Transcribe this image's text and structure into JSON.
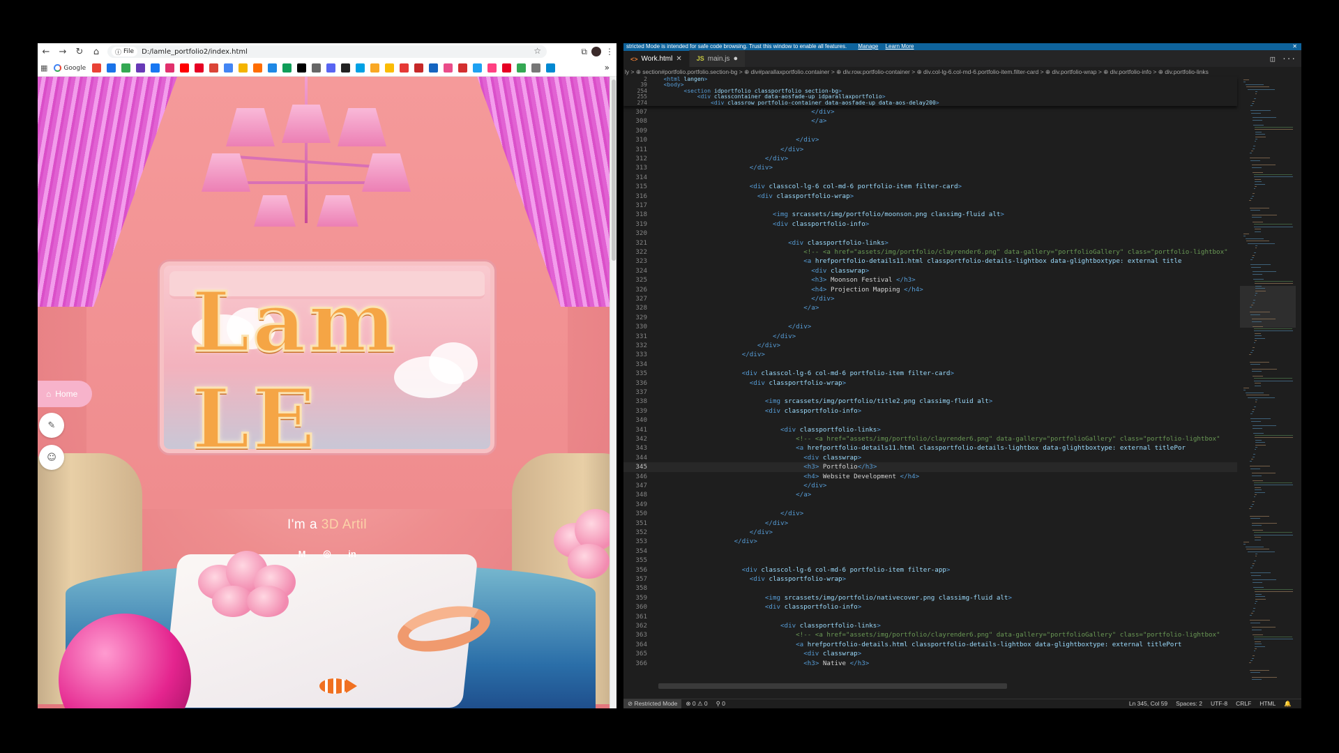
{
  "browser": {
    "nav": {
      "back": "←",
      "forward": "→",
      "reload": "↻",
      "home": "⌂"
    },
    "chip_label": "File",
    "url": "D:/lamle_portfolio2/index.html",
    "star": "☆",
    "right_icons": [
      "⧉",
      "⋮"
    ],
    "bookmark_google": "Google",
    "bookmark_more": "»",
    "bookmark_colors": [
      "#e94235",
      "#1a73e8",
      "#34a853",
      "#673ab7",
      "#1877f2",
      "#e1306c",
      "#ff0000",
      "#e60023",
      "#db4437",
      "#4285f4",
      "#f4b400",
      "#ff6d00",
      "#1e88e5",
      "#0f9d58",
      "#000000",
      "#666666",
      "#5865f2",
      "#222222",
      "#00a1e4",
      "#f9a825",
      "#fbbc04",
      "#e53935",
      "#c62828",
      "#1565c0",
      "#ea4c89",
      "#d32f2f",
      "#1da1f2",
      "#ff4081",
      "#e60023",
      "#34a853",
      "#777777",
      "#0288d1"
    ]
  },
  "page": {
    "logo": "Lam LE",
    "hero_prefix": "I'm a ",
    "hero_accent": "3D Artil",
    "social": {
      "mail": "M",
      "instagram": "◎",
      "linkedin": "in"
    },
    "nav_home": "Home",
    "nav_home_icon": "⌂",
    "nav_brush_icon": "✎",
    "nav_user_icon": "☺"
  },
  "vscode": {
    "banner": "stricted Mode is intended for safe code browsing. Trust this window to enable all features.",
    "banner_manage": "Manage",
    "banner_learn": "Learn More",
    "banner_close": "✕",
    "tabs": [
      {
        "icon": "<>",
        "label": "Work.html",
        "close": "✕"
      },
      {
        "icon": "JS",
        "label": "main.js",
        "close": "●"
      }
    ],
    "tab_actions": [
      "◫",
      "···"
    ],
    "breadcrumb": "ly > ⊕ section#portfolio.portfolio.section-bg > ⊕ div#parallaxportfolio.container > ⊕ div.row.portfolio-container > ⊕ div.col-lg-6.col-md-6.portfolio-item.filter-card > ⊕ div.portfolio-wrap > ⊕ div.portfolio-info > ⊕ div.portfolio-links",
    "sticky_lines": [
      {
        "n": "2",
        "code": "  <html lang=\"en\">"
      },
      {
        "n": "39",
        "code": "  <body>"
      },
      {
        "n": "254",
        "code": "        <section id=\"portfolio\" class=\"portfolio section-bg\">"
      },
      {
        "n": "255",
        "code": "            <div class=\"container\" data-aos=\"fade-up\" id=\"parallaxportfolio\">"
      },
      {
        "n": "274",
        "code": "                <div class=\"row portfolio-container\" data-aos=\"fade-up\" data-aos-delay=\"200\">"
      }
    ],
    "lines": [
      {
        "n": "307",
        "code": "                                        </div>"
      },
      {
        "n": "308",
        "code": "                                        </a>"
      },
      {
        "n": "309",
        "code": ""
      },
      {
        "n": "310",
        "code": "                                    </div>"
      },
      {
        "n": "311",
        "code": "                                </div>"
      },
      {
        "n": "312",
        "code": "                            </div>"
      },
      {
        "n": "313",
        "code": "                        </div>"
      },
      {
        "n": "314",
        "code": ""
      },
      {
        "n": "315",
        "code": "                        <div class=\"col-lg-6 col-md-6 portfolio-item filter-card\">"
      },
      {
        "n": "316",
        "code": "                          <div class=\"portfolio-wrap\">"
      },
      {
        "n": "317",
        "code": ""
      },
      {
        "n": "318",
        "code": "                              <img src=\"assets/img/portfolio/moonson.png\" class=\"img-fluid\" alt=\"\">"
      },
      {
        "n": "319",
        "code": "                              <div class=\"portfolio-info\">"
      },
      {
        "n": "320",
        "code": ""
      },
      {
        "n": "321",
        "code": "                                  <div class=\"portfolio-links\">"
      },
      {
        "n": "322",
        "code": "                                      <!-- <a href=\"assets/img/portfolio/clayrender6.png\" data-gallery=\"portfolioGallery\" class=\"portfolio-lightbox\""
      },
      {
        "n": "323",
        "code": "                                      <a href=\"portfolio-details11.html\" class=\"portfolio-details-lightbox\" data-glightbox=\"type: external\" title=\""
      },
      {
        "n": "324",
        "code": "                                        <div class=\"wrap\">"
      },
      {
        "n": "325",
        "code": "                                        <h3> Moonson Festival </h3>"
      },
      {
        "n": "326",
        "code": "                                        <h4> Projection Mapping </h4>"
      },
      {
        "n": "327",
        "code": "                                        </div>"
      },
      {
        "n": "328",
        "code": "                                      </a>"
      },
      {
        "n": "329",
        "code": ""
      },
      {
        "n": "330",
        "code": "                                  </div>"
      },
      {
        "n": "331",
        "code": "                              </div>"
      },
      {
        "n": "332",
        "code": "                          </div>"
      },
      {
        "n": "333",
        "code": "                      </div>"
      },
      {
        "n": "334",
        "code": ""
      },
      {
        "n": "335",
        "code": "                      <div class=\"col-lg-6 col-md-6 portfolio-item filter-card\">"
      },
      {
        "n": "336",
        "code": "                        <div class=\"portfolio-wrap\">"
      },
      {
        "n": "337",
        "code": ""
      },
      {
        "n": "338",
        "code": "                            <img src=\"assets/img/portfolio/title2.png\" class=\"img-fluid\" alt=\"\">"
      },
      {
        "n": "339",
        "code": "                            <div class=\"portfolio-info\">"
      },
      {
        "n": "340",
        "code": ""
      },
      {
        "n": "341",
        "code": "                                <div class=\"portfolio-links\">"
      },
      {
        "n": "342",
        "code": "                                    <!-- <a href=\"assets/img/portfolio/clayrender6.png\" data-gallery=\"portfolioGallery\" class=\"portfolio-lightbox\""
      },
      {
        "n": "343",
        "code": "                                    <a href=\"portfolio-details11.html\" class=\"portfolio-details-lightbox\" data-glightbox=\"type: external\" title=\"Por"
      },
      {
        "n": "344",
        "code": "                                      <div class=\"wrap\">"
      },
      {
        "n": "345",
        "code": "                                      <h3> Portfolio</h3>"
      },
      {
        "n": "346",
        "code": "                                      <h4> Website Development </h4>"
      },
      {
        "n": "347",
        "code": "                                      </div>"
      },
      {
        "n": "348",
        "code": "                                    </a>"
      },
      {
        "n": "349",
        "code": ""
      },
      {
        "n": "350",
        "code": "                                </div>"
      },
      {
        "n": "351",
        "code": "                            </div>"
      },
      {
        "n": "352",
        "code": "                        </div>"
      },
      {
        "n": "353",
        "code": "                    </div>"
      },
      {
        "n": "354",
        "code": ""
      },
      {
        "n": "355",
        "code": ""
      },
      {
        "n": "356",
        "code": "                      <div class=\"col-lg-6 col-md-6 portfolio-item filter-app\">"
      },
      {
        "n": "357",
        "code": "                        <div class=\"portfolio-wrap\">"
      },
      {
        "n": "358",
        "code": ""
      },
      {
        "n": "359",
        "code": "                            <img src=\"assets/img/portfolio/nativecover.png\" class=\"img-fluid\" alt=\"\">"
      },
      {
        "n": "360",
        "code": "                            <div class=\"portfolio-info\">"
      },
      {
        "n": "361",
        "code": ""
      },
      {
        "n": "362",
        "code": "                                <div class=\"portfolio-links\">"
      },
      {
        "n": "363",
        "code": "                                    <!-- <a href=\"assets/img/portfolio/clayrender6.png\" data-gallery=\"portfolioGallery\" class=\"portfolio-lightbox\""
      },
      {
        "n": "364",
        "code": "                                    <a href=\"portfolio-details.html\" class=\"portfolio-details-lightbox\" data-glightbox=\"type: external\" title=\"Port"
      },
      {
        "n": "365",
        "code": "                                      <div class=\"wrap\">"
      },
      {
        "n": "366",
        "code": "                                      <h3> Native </h3>"
      }
    ],
    "current_line": "345",
    "status": {
      "restricted": "⊘ Restricted Mode",
      "problems": "⊗ 0 ⚠ 0",
      "ports": "⚲ 0",
      "position": "Ln 345, Col 59",
      "spaces": "Spaces: 2",
      "encoding": "UTF-8",
      "eol": "CRLF",
      "language": "HTML",
      "bell": "🔔"
    }
  }
}
